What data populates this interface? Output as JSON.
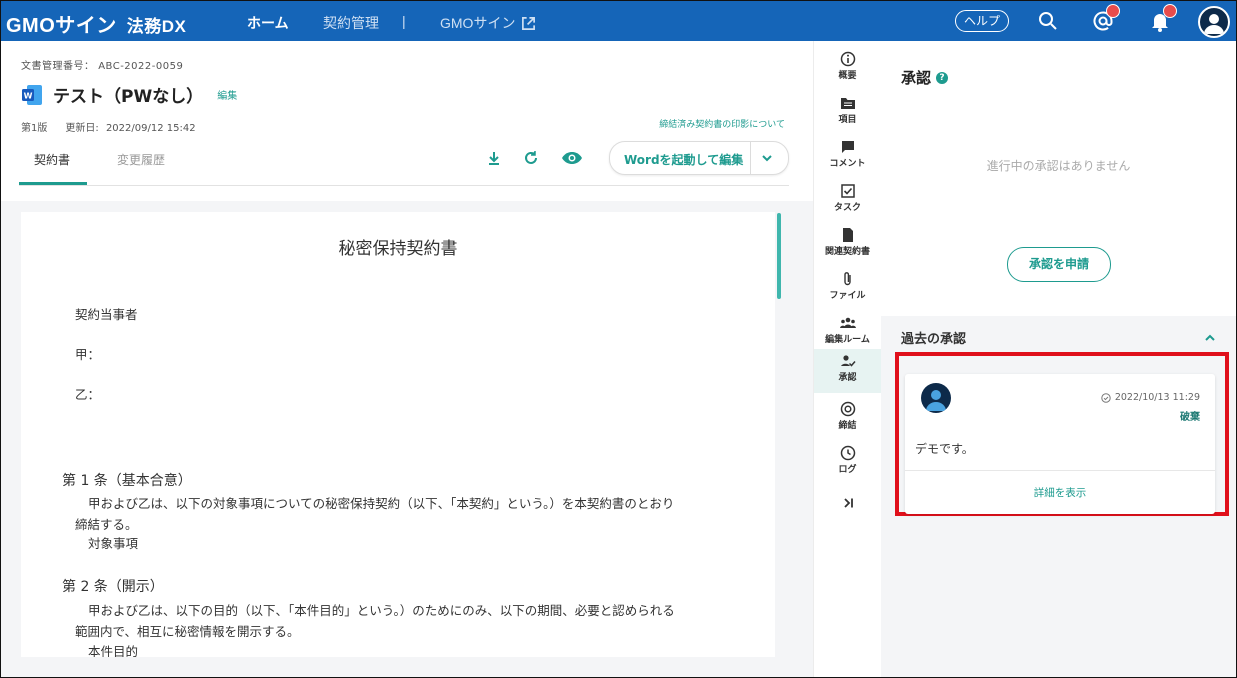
{
  "header": {
    "logo": "GMOサイン",
    "product": "法務DX",
    "nav": {
      "home": "ホーム",
      "contracts": "契約管理",
      "separator": "|",
      "gmosign": "GMOサイン"
    },
    "help": "ヘルプ",
    "icons": [
      "search-icon",
      "mention-icon",
      "bell-icon",
      "user-avatar-icon"
    ],
    "colors": {
      "bar": "#1565b8",
      "badge": "#e84c4c"
    }
  },
  "document": {
    "number_label": "文書管理番号：",
    "number": "ABC-2022-0059",
    "title": "テスト（PWなし）",
    "edit": "編集",
    "version": "第1版",
    "updated_label": "更新日:",
    "updated": "2022/09/12 15:42",
    "seal_link": "締結済み契約書の印影について",
    "tabs": {
      "contract": "契約書",
      "history": "変更履歴"
    },
    "word_button": "Wordを起動して編集"
  },
  "paper": {
    "title": "秘密保持契約書",
    "parties": "契約当事者",
    "party_a": "甲：",
    "party_b": "乙：",
    "art1_heading": "第 1 条（基本合意）",
    "art1_line1": "甲および乙は、以下の対象事項についての秘密保持契約（以下、「本契約」という。）を本契約書のとおり",
    "art1_line2": "締結する。",
    "art1_item": "対象事項",
    "art2_heading": "第 2 条（開示）",
    "art2_line1": "甲および乙は、以下の目的（以下、「本件目的」という。）のためにのみ、以下の期間、必要と認められる",
    "art2_line2": "範囲内で、相互に秘密情報を開示する。",
    "art2_item": "本件目的"
  },
  "rail": {
    "items": [
      {
        "label": "概要",
        "icon": "info-icon"
      },
      {
        "label": "項目",
        "icon": "folder-icon"
      },
      {
        "label": "コメント",
        "icon": "comment-icon"
      },
      {
        "label": "タスク",
        "icon": "checkbox-icon"
      },
      {
        "label": "関連契約書",
        "icon": "document-icon"
      },
      {
        "label": "ファイル",
        "icon": "paperclip-icon"
      },
      {
        "label": "編集ルーム",
        "icon": "group-icon"
      },
      {
        "label": "承認",
        "icon": "approval-icon"
      },
      {
        "label": "締結",
        "icon": "target-icon"
      },
      {
        "label": "ログ",
        "icon": "clock-icon"
      }
    ],
    "selected": "承認"
  },
  "approval": {
    "title": "承認",
    "empty": "進行中の承認はありません",
    "apply_button": "承認を申請",
    "past_title": "過去の承認",
    "card": {
      "date": "2022/10/13 11:29",
      "status": "破棄",
      "message": "デモです。",
      "detail": "詳細を表示"
    },
    "colors": {
      "accent": "#1e9b8f",
      "highlight": "#e0101b"
    }
  }
}
